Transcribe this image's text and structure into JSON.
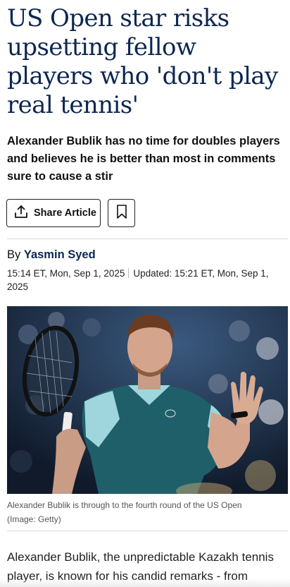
{
  "article": {
    "headline": "US Open star risks upsetting fellow players who 'don't play real tennis'",
    "standfirst": "Alexander Bublik has no time for doubles players and believes he is better than most in comments sure to cause a stir",
    "share_label": "Share Article",
    "byline_prefix": "By",
    "author": "Yasmin Syed",
    "published": "15:14 ET, Mon, Sep 1, 2025",
    "updated": "Updated: 15:21 ET, Mon, Sep 1, 2025",
    "image_caption": "Alexander Bublik is through to the fourth round of the US Open",
    "image_credit": "(Image: Getty)",
    "body_first_paragraph": "Alexander Bublik, the unpredictable Kazakh tennis player, is known for his candid remarks - from"
  },
  "icons": {
    "share": "share-upload-icon",
    "bookmark": "bookmark-icon"
  },
  "colors": {
    "headline": "#0c2650",
    "author": "#0c2650",
    "divider": "#dcdcdc"
  }
}
